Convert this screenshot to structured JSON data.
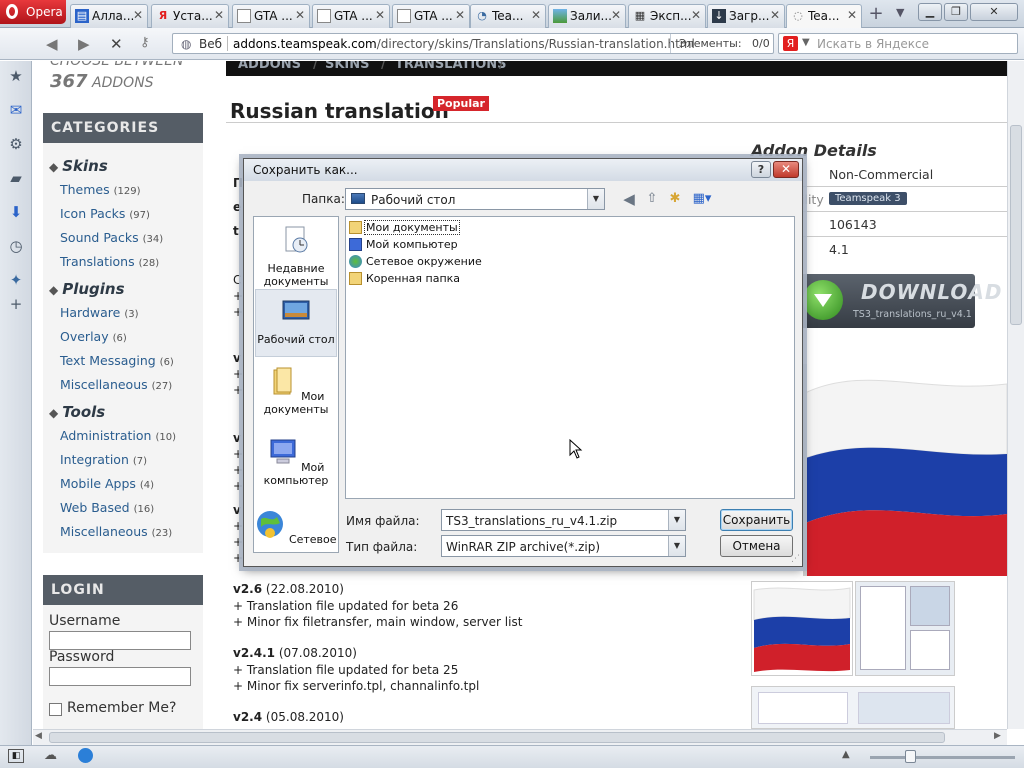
{
  "browser": {
    "opera_label": "Opera",
    "tabs": [
      {
        "label": "Алла...",
        "icon": "bookmark-icon"
      },
      {
        "label": "Уста...",
        "icon": "yandex-icon"
      },
      {
        "label": "GTA ...",
        "icon": "page-icon"
      },
      {
        "label": "GTA ...",
        "icon": "page-icon"
      },
      {
        "label": "GTA ...",
        "icon": "page-icon"
      },
      {
        "label": "Tea...",
        "icon": "teamspeak-icon"
      },
      {
        "label": "Зали...",
        "icon": "image-icon"
      },
      {
        "label": "Эксп...",
        "icon": "grid-icon"
      },
      {
        "label": "Загр...",
        "icon": "download-icon"
      },
      {
        "label": "Tea...",
        "icon": "loading-icon"
      }
    ],
    "web_label": "Веб",
    "url_domain": "addons.teamspeak.com",
    "url_path": "/directory/skins/Translations/Russian-translation.html",
    "elements_label": "Элементы:",
    "elements_value": "0/0",
    "search_placeholder": "Искать в Яндексе"
  },
  "page": {
    "choose": "CHOOSE BETWEEN",
    "count_num": "367",
    "count_word": "ADDONS",
    "categories_head": "CATEGORIES",
    "categories": [
      {
        "name": "Skins",
        "items": [
          {
            "label": "Themes",
            "count": "(129)"
          },
          {
            "label": "Icon Packs",
            "count": "(97)"
          },
          {
            "label": "Sound Packs",
            "count": "(34)"
          },
          {
            "label": "Translations",
            "count": "(28)"
          }
        ]
      },
      {
        "name": "Plugins",
        "items": [
          {
            "label": "Hardware",
            "count": "(3)"
          },
          {
            "label": "Overlay",
            "count": "(6)"
          },
          {
            "label": "Text Messaging",
            "count": "(6)"
          },
          {
            "label": "Miscellaneous",
            "count": "(27)"
          }
        ]
      },
      {
        "name": "Tools",
        "items": [
          {
            "label": "Administration",
            "count": "(10)"
          },
          {
            "label": "Integration",
            "count": "(7)"
          },
          {
            "label": "Mobile Apps",
            "count": "(4)"
          },
          {
            "label": "Web Based",
            "count": "(16)"
          },
          {
            "label": "Miscellaneous",
            "count": "(23)"
          }
        ]
      }
    ],
    "login_head": "LOGIN",
    "username_label": "Username",
    "password_label": "Password",
    "remember_label": "Remember Me?",
    "breadcrumb": [
      "ADDONS",
      "SKINS",
      "TRANSLATIONS"
    ],
    "title": "Russian translation",
    "badge": "Popular",
    "details_head": "Addon Details",
    "details_values": [
      "Non-Commercial",
      "Teamspeak 3",
      "106143",
      "4.1"
    ],
    "details_partial_label": "ility",
    "download_label": "DOWNLOAD",
    "download_file": "TS3_translations_ru_v4.1",
    "changelog": [
      {
        "version": "v2.6",
        "date": "(22.08.2010)",
        "lines": [
          "+ Translation file updated for beta 26",
          "+ Minor fix filetransfer, main window, server list"
        ]
      },
      {
        "version": "v2.4.1",
        "date": "(07.08.2010)",
        "lines": [
          "+ Translation file updated for beta 25",
          "+ Minor fix serverinfo.tpl, channalinfo.tpl"
        ]
      },
      {
        "version": "v2.4",
        "date": "(05.08.2010)",
        "lines": []
      }
    ]
  },
  "dialog": {
    "title": "Сохранить как...",
    "help": "?",
    "close": "✕",
    "folder_label": "Папка:",
    "folder_value": "Рабочий стол",
    "places": [
      "Недавние документы",
      "Рабочий стол",
      "Мои документы",
      "Мой компьютер",
      "Сетевое"
    ],
    "files": [
      "Мои документы",
      "Мой компьютер",
      "Сетевое окружение",
      "Коренная папка"
    ],
    "filename_label": "Имя файла:",
    "filename_value": "TS3_translations_ru_v4.1.zip",
    "filetype_label": "Тип файла:",
    "filetype_value": "WinRAR ZIP archive(*.zip)",
    "save_button": "Сохранить",
    "cancel_button": "Отмена"
  }
}
